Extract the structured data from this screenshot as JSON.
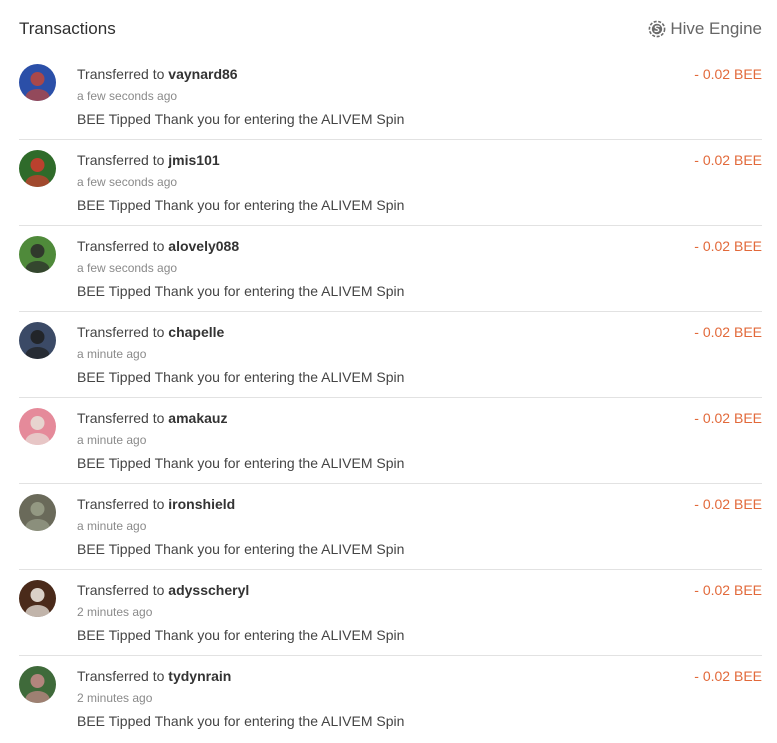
{
  "header": {
    "title": "Transactions",
    "source_label": "Hive Engine",
    "source_icon": "hive-engine-logo-icon"
  },
  "colors": {
    "amount": "#e2693a",
    "divider": "#e2e2e2"
  },
  "transactions": [
    {
      "prefix": "Transferred to",
      "user": "vaynard86",
      "time": "a few seconds ago",
      "memo": "BEE Tipped Thank you for entering the ALIVEM Spin",
      "amount": "- 0.02 BEE",
      "avatar_colors": [
        "#2b4fa8",
        "#c0473a"
      ]
    },
    {
      "prefix": "Transferred to",
      "user": "jmis101",
      "time": "a few seconds ago",
      "memo": "BEE Tipped Thank you for entering the ALIVEM Spin",
      "amount": "- 0.02 BEE",
      "avatar_colors": [
        "#2f6b2a",
        "#d23a2f"
      ]
    },
    {
      "prefix": "Transferred to",
      "user": "alovely088",
      "time": "a few seconds ago",
      "memo": "BEE Tipped Thank you for entering the ALIVEM Spin",
      "amount": "- 0.02 BEE",
      "avatar_colors": [
        "#4f8a3a",
        "#2a2a2a"
      ]
    },
    {
      "prefix": "Transferred to",
      "user": "chapelle",
      "time": "a minute ago",
      "memo": "BEE Tipped Thank you for entering the ALIVEM Spin",
      "amount": "- 0.02 BEE",
      "avatar_colors": [
        "#3b4a66",
        "#1f1f1f"
      ]
    },
    {
      "prefix": "Transferred to",
      "user": "amakauz",
      "time": "a minute ago",
      "memo": "BEE Tipped Thank you for entering the ALIVEM Spin",
      "amount": "- 0.02 BEE",
      "avatar_colors": [
        "#e58a9a",
        "#e8e0d8"
      ]
    },
    {
      "prefix": "Transferred to",
      "user": "ironshield",
      "time": "a minute ago",
      "memo": "BEE Tipped Thank you for entering the ALIVEM Spin",
      "amount": "- 0.02 BEE",
      "avatar_colors": [
        "#6a6a5a",
        "#9aa08a"
      ]
    },
    {
      "prefix": "Transferred to",
      "user": "adysscheryl",
      "time": "2 minutes ago",
      "memo": "BEE Tipped Thank you for entering the ALIVEM Spin",
      "amount": "- 0.02 BEE",
      "avatar_colors": [
        "#4a2a1a",
        "#f4efe8"
      ]
    },
    {
      "prefix": "Transferred to",
      "user": "tydynrain",
      "time": "2 minutes ago",
      "memo": "BEE Tipped Thank you for entering the ALIVEM Spin",
      "amount": "- 0.02 BEE",
      "avatar_colors": [
        "#3f6a3a",
        "#c88a8a"
      ]
    }
  ]
}
